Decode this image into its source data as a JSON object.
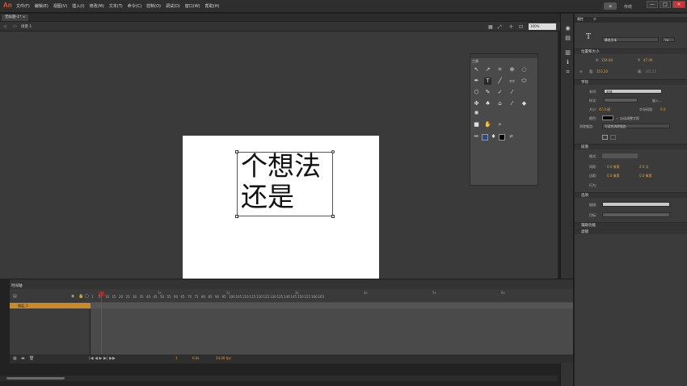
{
  "app": {
    "logo": "An",
    "menus": [
      "文件(F)",
      "编辑(E)",
      "视图(V)",
      "插入(I)",
      "修改(M)",
      "文本(T)",
      "命令(C)",
      "控制(O)",
      "调试(D)",
      "窗口(W)",
      "帮助(H)"
    ]
  },
  "workspace": {
    "label": "传统",
    "button": "⊞"
  },
  "window_controls": {
    "minimize": "—",
    "restore": "□",
    "close": "✕"
  },
  "document": {
    "tab": "无标题-1* ×",
    "scene": "场景 1",
    "zoom": "100%"
  },
  "stage": {
    "text_line1": "个想法",
    "text_line2": "还是"
  },
  "tools": {
    "title": "工具"
  },
  "properties": {
    "tab": "属性",
    "tab2": "库",
    "text_tool_type": "静态文本",
    "position_section": "位置和大小",
    "x_label": "X:",
    "x_value": "154.00",
    "y_label": "Y:",
    "y_value": "47.00",
    "w_label": "宽:",
    "w_value": "253.20",
    "h_label": "高:",
    "h_value": "105.25",
    "char_section": "字符",
    "family_label": "系列:",
    "family_value": "宋体",
    "style_label": "样式:",
    "embed_label": "嵌入...",
    "size_label": "大小:",
    "size_value": "47.0 磅",
    "spacing_label": "字母间距:",
    "spacing_value": "0.0",
    "color_label": "颜色:",
    "auto_kern": "自动调整字距",
    "aa_label": "消除锯齿:",
    "aa_value": "可读性消除锯齿",
    "para_section": "段落",
    "format_label": "格式:",
    "spacing2_label": "间距:",
    "indent_value": "0.0 像素",
    "line_value": "2.0 点",
    "margin_label": "边距:",
    "margin_left": "0.0 像素",
    "margin_right": "0.0 像素",
    "behavior_label": "行为:",
    "options_section": "选项",
    "link_label": "链接:",
    "target_label": "目标:",
    "filters_section": "辅助功能",
    "filters2_section": "滤镜"
  },
  "timeline": {
    "tab": "时间轴",
    "layer_name": "图层_1",
    "frame_numbers": [
      "1",
      "5",
      "10",
      "15",
      "20",
      "25",
      "30",
      "35",
      "40",
      "45",
      "50",
      "55",
      "60",
      "65",
      "70",
      "75",
      "80",
      "85",
      "90",
      "95",
      "100",
      "105",
      "110",
      "115",
      "120",
      "125",
      "130",
      "135",
      "140",
      "145",
      "150",
      "155",
      "160",
      "165"
    ],
    "second_marks": [
      "1s",
      "2s",
      "3s",
      "4s",
      "5s",
      "6s"
    ],
    "fps": "24.00 fps",
    "time": "0.0s",
    "current_frame": "1"
  },
  "colors": {
    "accent": "#e8572a",
    "layer": "#c98a2a",
    "playhead": "#dd2222",
    "value": "#e8a23a"
  }
}
